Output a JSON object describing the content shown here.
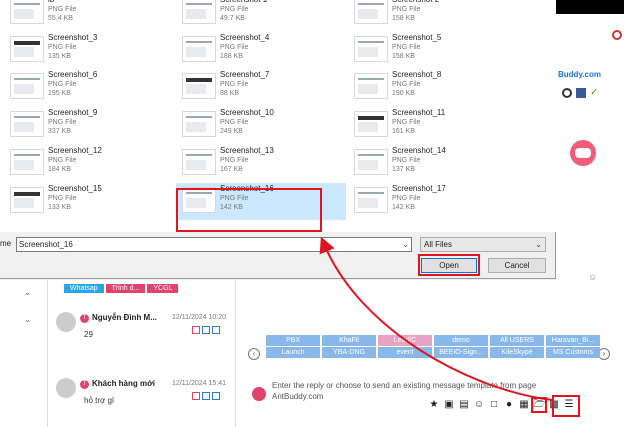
{
  "dialog": {
    "files": [
      {
        "name": "lb",
        "type": "PNG File",
        "size": "55.4 KB"
      },
      {
        "name": "Screenshot 1",
        "type": "PNG File",
        "size": "49.7 KB"
      },
      {
        "name": "Screenshot 2",
        "type": "PNG File",
        "size": "158 KB"
      },
      {
        "name": "Screenshot_3",
        "type": "PNG File",
        "size": "135 KB"
      },
      {
        "name": "Screenshot_4",
        "type": "PNG File",
        "size": "188 KB"
      },
      {
        "name": "Screenshot_5",
        "type": "PNG File",
        "size": "158 KB"
      },
      {
        "name": "Screenshot_6",
        "type": "PNG File",
        "size": "195 KB"
      },
      {
        "name": "Screenshot_7",
        "type": "PNG File",
        "size": "88 KB"
      },
      {
        "name": "Screenshot_8",
        "type": "PNG File",
        "size": "190 KB"
      },
      {
        "name": "Screenshot_9",
        "type": "PNG File",
        "size": "337 KB"
      },
      {
        "name": "Screenshot_10",
        "type": "PNG File",
        "size": "249 KB"
      },
      {
        "name": "Screenshot_11",
        "type": "PNG File",
        "size": "161 KB"
      },
      {
        "name": "Screenshot_12",
        "type": "PNG File",
        "size": "184 KB"
      },
      {
        "name": "Screenshot_13",
        "type": "PNG File",
        "size": "167 KB"
      },
      {
        "name": "Screenshot_14",
        "type": "PNG File",
        "size": "137 KB"
      },
      {
        "name": "Screenshot_15",
        "type": "PNG File",
        "size": "133 KB"
      },
      {
        "name": "Screenshot_16",
        "type": "PNG File",
        "size": "142 KB"
      },
      {
        "name": "Screenshot_17",
        "type": "PNG File",
        "size": "142 KB"
      }
    ],
    "selected_index": 16,
    "file_name_label": "me",
    "file_name_value": "Screenshot_16",
    "filter_value": "All Files",
    "open_label": "Open",
    "cancel_label": "Cancel"
  },
  "background": {
    "brand": "Buddy.com",
    "tags": [
      {
        "label": "Whatsap",
        "color": "#2aa6e6"
      },
      {
        "label": "Trình d...",
        "color": "#e0436e"
      },
      {
        "label": "YCGL",
        "color": "#e0436e"
      }
    ],
    "conversations": [
      {
        "name": "Nguyễn Đình M...",
        "time": "12/11/2024 10:20",
        "message": "29"
      },
      {
        "name": "Khách hàng mới",
        "time": "12/11/2024 15:41",
        "message": "hỏ trợ gì"
      }
    ],
    "templates": [
      "PBX",
      "KhaFil",
      "Lead/C",
      "demo",
      "All USERS",
      "Haravan_Bi...",
      "Launch",
      "YBA-DNG",
      "event",
      "BEEIO-Sign...",
      "KileSkype",
      "MS Customs"
    ],
    "reply_hint": "Enter the reply or choose to send an existing message template from page",
    "reply_sub": "AntBuddy.com"
  },
  "colors": {
    "annotation_red": "#e0141e",
    "selection_blue": "#cce8ff",
    "tag_blue": "#2aa6e6",
    "tag_pink": "#e0436e"
  }
}
